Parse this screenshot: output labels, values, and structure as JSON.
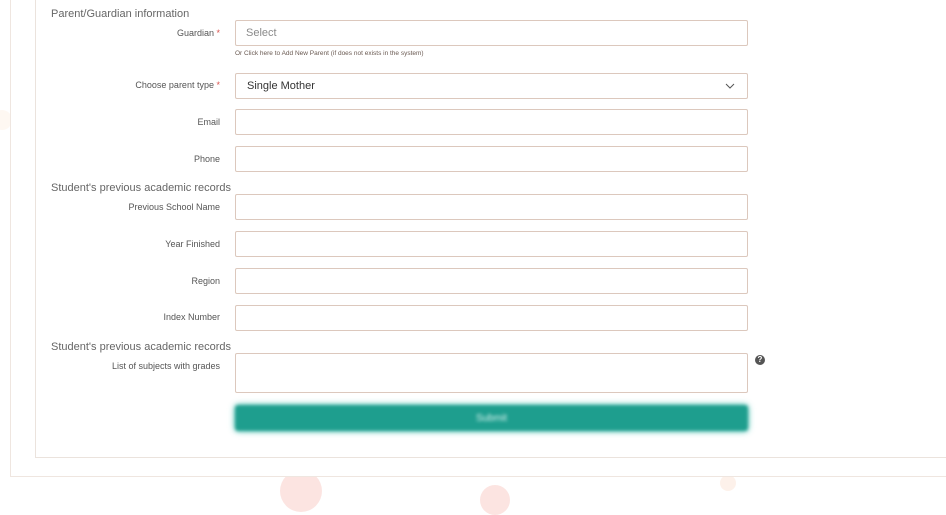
{
  "sections": {
    "guardian_title": "Parent/Guardian information",
    "records_title_1": "Student's previous academic records",
    "records_title_2": "Student's previous academic records"
  },
  "guardian": {
    "label": "Guardian",
    "placeholder": "Select",
    "helper_link": "Or Click here to Add New Parent (if does not exists in the system)"
  },
  "parent_type": {
    "label": "Choose parent type",
    "value": "Single Mother"
  },
  "required_marker": "*",
  "email": {
    "label": "Email",
    "value": ""
  },
  "phone": {
    "label": "Phone",
    "value": ""
  },
  "previous_school": {
    "label": "Previous School Name",
    "value": ""
  },
  "year_finished": {
    "label": "Year Finished",
    "value": ""
  },
  "region": {
    "label": "Region",
    "value": ""
  },
  "index_number": {
    "label": "Index Number",
    "value": ""
  },
  "subjects": {
    "label": "List of subjects with grades",
    "value": ""
  },
  "help_glyph": "?",
  "icons": {
    "help": "question-circle-icon",
    "dropdown": "chevron-down-icon"
  },
  "colors": {
    "accent": "#1e9e8e",
    "required": "#d9534f",
    "border": "#dcc8bd"
  },
  "submit": {
    "label": "Submit"
  }
}
